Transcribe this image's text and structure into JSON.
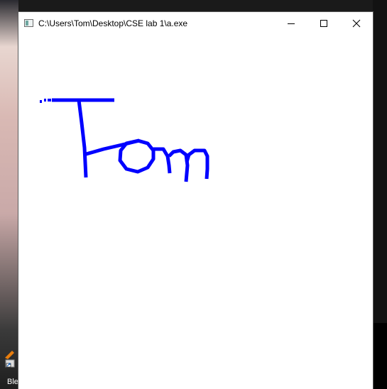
{
  "window": {
    "title": "C:\\Users\\Tom\\Desktop\\CSE lab 1\\a.exe",
    "controls": {
      "minimize_icon": "minimize-icon",
      "maximize_icon": "maximize-icon",
      "close_icon": "close-icon"
    }
  },
  "canvas": {
    "drawing_text": "Tom",
    "stroke_color": "#0000ff",
    "background_color": "#ffffff"
  },
  "desktop": {
    "icon_label": "Ble",
    "icon_name": "shortcut-app-icon"
  }
}
